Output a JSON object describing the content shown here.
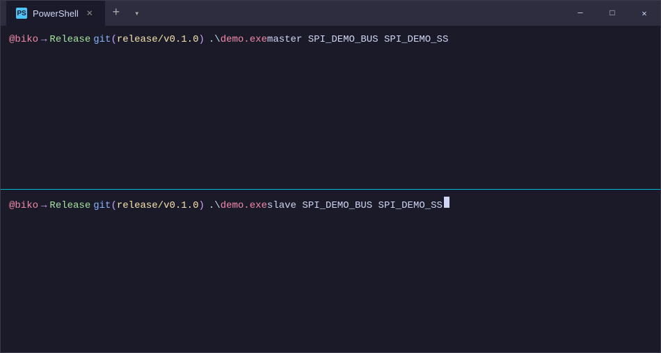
{
  "window": {
    "title": "PowerShell",
    "tab_icon_text": "PS"
  },
  "titlebar": {
    "tab_label": "PowerShell",
    "new_tab_icon": "+",
    "dropdown_icon": "▾",
    "minimize_icon": "─",
    "maximize_icon": "□",
    "close_icon": "✕"
  },
  "panes": [
    {
      "id": "top",
      "user": "@biko",
      "arrow": "→",
      "dir": "Release",
      "git_prefix": "git(",
      "git_branch": "release/v0.1.0",
      "git_suffix": ")",
      "cmd_prefix": " .\\",
      "cmd_exe": "demo.exe",
      "cmd_args": " master SPI_DEMO_BUS SPI_DEMO_SS",
      "has_cursor": false
    },
    {
      "id": "bottom",
      "user": "@biko",
      "arrow": "→",
      "dir": "Release",
      "git_prefix": "git(",
      "git_branch": "release/v0.1.0",
      "git_suffix": ")",
      "cmd_prefix": " .\\",
      "cmd_exe": "demo.exe",
      "cmd_args": " slave SPI_DEMO_BUS SPI_DEMO_SS",
      "has_cursor": true
    }
  ]
}
